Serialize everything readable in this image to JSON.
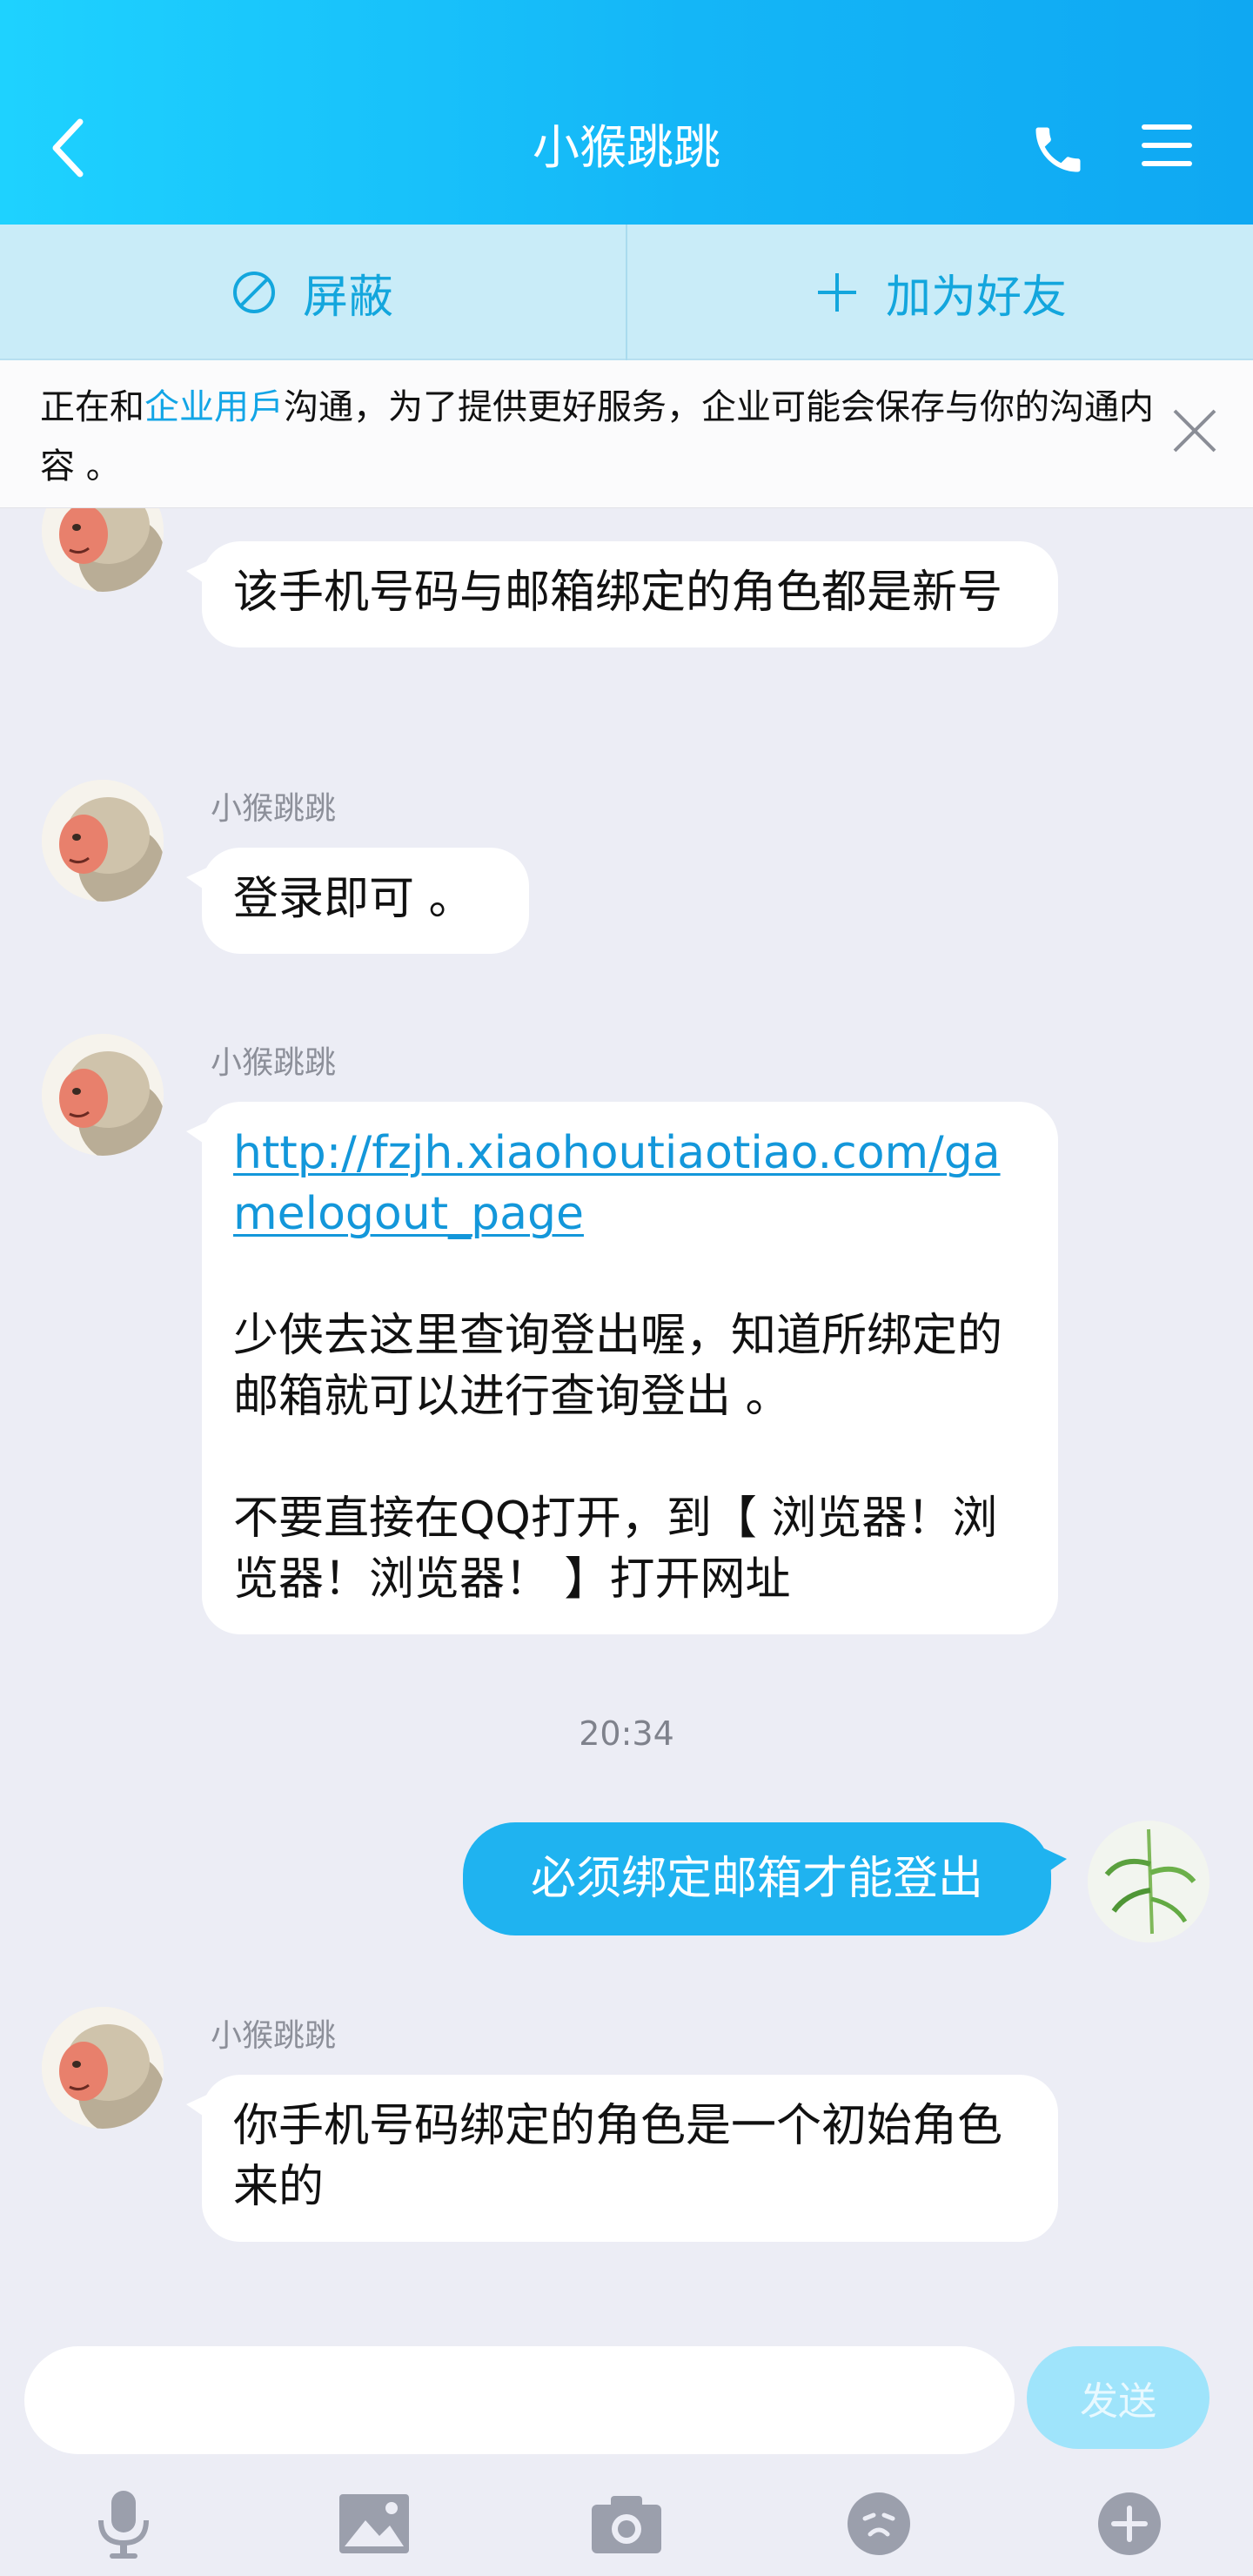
{
  "header": {
    "title": "小猴跳跳",
    "back_icon": "chevron-left-icon",
    "phone_icon": "phone-icon",
    "menu_icon": "menu-icon"
  },
  "actions": {
    "block_label": "屏蔽",
    "add_friend_label": "加为好友"
  },
  "notice": {
    "prefix": "正在和",
    "link": "企业用戶",
    "suffix": "沟通，为了提供更好服务，企业可能会保存与你的沟通内容 。"
  },
  "messages": [
    {
      "sender": "小猴跳跳",
      "text": "该手机号码与邮箱绑定的角色都是新号"
    },
    {
      "sender": "小猴跳跳",
      "text": "登录即可 。"
    },
    {
      "sender": "小猴跳跳",
      "url": "http://fzjh.xiaohoutiaotiao.com/gamelogout_page",
      "para1": "少侠去这里查询登出喔，知道所绑定的邮箱就可以进行查询登出 。",
      "para2": "不要直接在QQ打开，到【 浏览器！浏览器！浏览器！ 】打开网址"
    },
    {
      "timestamp": "20:34"
    },
    {
      "outgoing": true,
      "text": "必须绑定邮箱才能登出"
    },
    {
      "sender": "小猴跳跳",
      "text": "你手机号码绑定的角色是一个初始角色来的"
    }
  ],
  "input": {
    "value": "",
    "send_label": "发送"
  },
  "toolbar": {
    "icons": [
      "microphone-icon",
      "image-icon",
      "camera-icon",
      "emoji-icon",
      "plus-icon"
    ]
  },
  "colors": {
    "header_start": "#1ed2ff",
    "header_end": "#0fa8f2",
    "accent": "#13a6dd",
    "outgoing_bubble": "#1fb3f0",
    "send_button": "#9fe4fb"
  }
}
